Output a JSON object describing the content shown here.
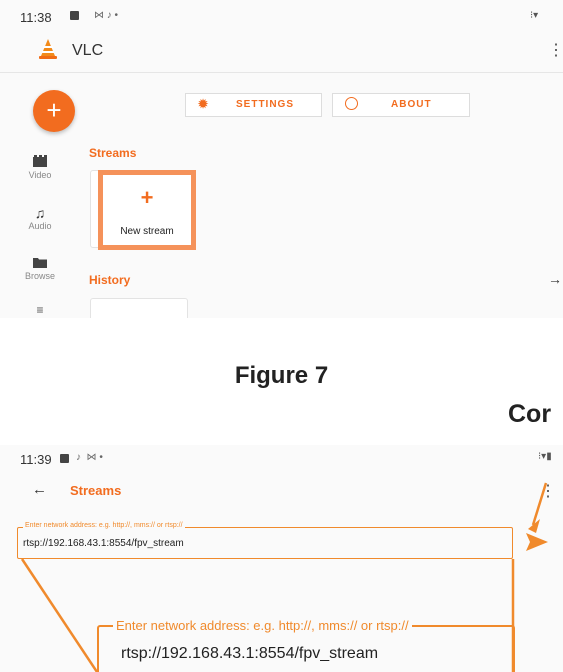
{
  "figure_caption": "Figure 7",
  "cropped_label": "Cor",
  "top_screen": {
    "status_time": "11:38",
    "app_title": "VLC",
    "settings_label": "SETTINGS",
    "about_label": "ABOUT",
    "fab_label": "+",
    "nav": [
      {
        "label": "Video"
      },
      {
        "label": "Audio"
      },
      {
        "label": "Browse"
      }
    ],
    "streams_title": "Streams",
    "new_stream_plus": "+",
    "new_stream_label": "New stream",
    "history_title": "History",
    "accent_color": "#f26c1f",
    "highlight_color": "#f5925a"
  },
  "bottom_screen": {
    "status_time": "11:39",
    "back_title": "Streams",
    "field_legend": "Enter network address: e.g. http://, mms:// or rtsp://",
    "field_value": "rtsp://192.168.43.1:8554/fpv_stream",
    "zoom_legend": "Enter network address: e.g. http://, mms:// or rtsp://",
    "zoom_value": "rtsp://192.168.43.1:8554/fpv_stream",
    "accent_color": "#f08a2c"
  }
}
